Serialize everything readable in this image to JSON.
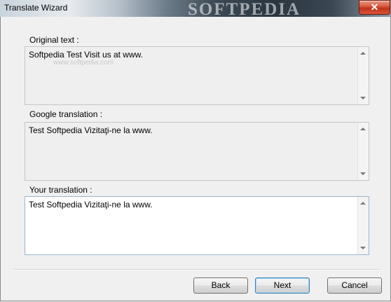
{
  "window": {
    "title": "Translate Wizard",
    "watermark": "SOFTPEDIA",
    "close_glyph": "✕"
  },
  "original": {
    "label": "Original text :",
    "text": "Softpedia Test Visit us at www.",
    "watermark_url": "www.softpedia.com"
  },
  "google": {
    "label": "Google translation :",
    "text": "Test Softpedia Vizitaţi-ne la www."
  },
  "yours": {
    "label": "Your translation :",
    "text": "Test Softpedia Vizitaţi-ne la www."
  },
  "buttons": {
    "back": "Back",
    "next": "Next",
    "cancel": "Cancel"
  },
  "colors": {
    "close_button": "#c1321a",
    "default_button_border": "#3c7fb1"
  }
}
